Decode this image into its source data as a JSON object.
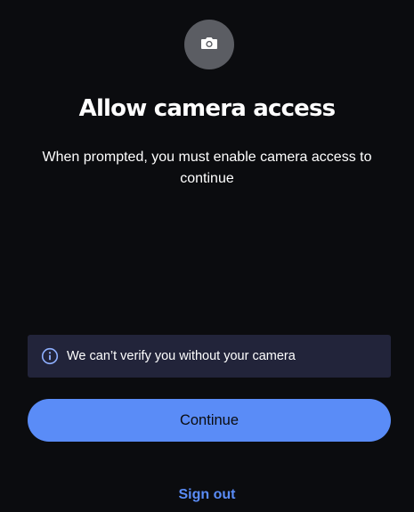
{
  "header": {
    "icon": "camera-icon",
    "title": "Allow camera access",
    "subtitle": "When prompted, you must enable camera access to continue"
  },
  "notice": {
    "icon": "info-icon",
    "text": "We can’t verify you without your camera"
  },
  "actions": {
    "continue_label": "Continue",
    "signout_label": "Sign out"
  },
  "colors": {
    "background": "#0b0c0f",
    "accent": "#5a8cf7",
    "notice_background": "#22243a",
    "icon_badge": "#5b5d63"
  }
}
